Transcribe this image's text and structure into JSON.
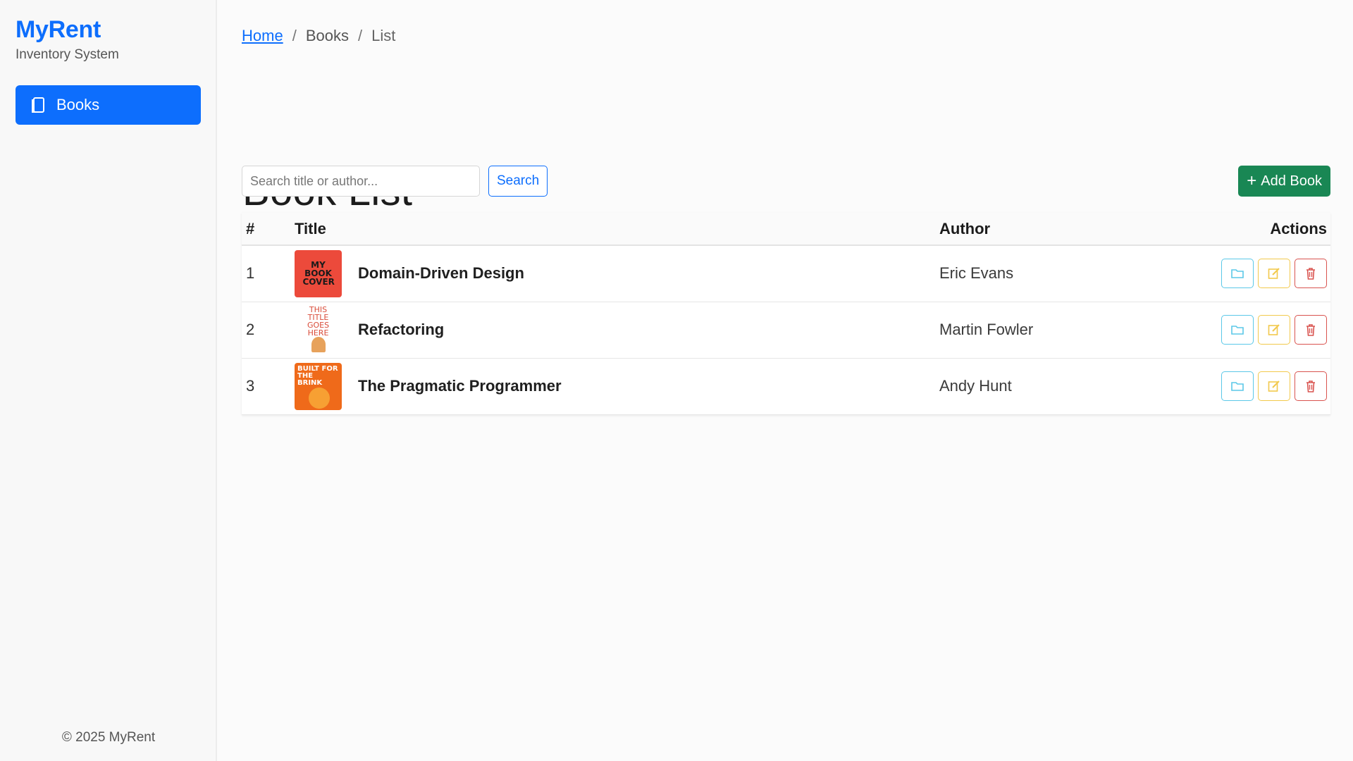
{
  "sidebar": {
    "brand_title": "MyRent",
    "brand_subtitle": "Inventory System",
    "nav_items": [
      {
        "label": "Books",
        "icon": "book-icon",
        "active": true
      }
    ],
    "footer": "© 2025 MyRent"
  },
  "breadcrumb": {
    "home": "Home",
    "section": "Books",
    "current": "List",
    "separator": "/"
  },
  "page": {
    "title": "Book List"
  },
  "toolbar": {
    "search_placeholder": "Search title or author...",
    "search_value": "",
    "search_label": "Search",
    "add_label": "Add Book",
    "add_icon": "plus-icon"
  },
  "table": {
    "columns": {
      "num": "#",
      "title": "Title",
      "author": "Author",
      "actions": "Actions"
    },
    "rows": [
      {
        "num": "1",
        "title": "Domain-Driven Design",
        "author": "Eric Evans",
        "cover_text": "MY BOOK COVER"
      },
      {
        "num": "2",
        "title": "Refactoring",
        "author": "Martin Fowler",
        "cover_text": "THIS TITLE GOES HERE"
      },
      {
        "num": "3",
        "title": "The Pragmatic Programmer",
        "author": "Andy Hunt",
        "cover_text": "BUILT FOR THE BRINK"
      }
    ],
    "row_actions": [
      {
        "icon": "folder-icon",
        "color": "#5bc8e8"
      },
      {
        "icon": "edit-icon",
        "color": "#f2c94c"
      },
      {
        "icon": "trash-icon",
        "color": "#d9534f"
      }
    ]
  },
  "colors": {
    "primary": "#0d6efd",
    "success": "#198754",
    "info": "#5bc8e8",
    "warning": "#f2c94c",
    "danger": "#d9534f"
  }
}
